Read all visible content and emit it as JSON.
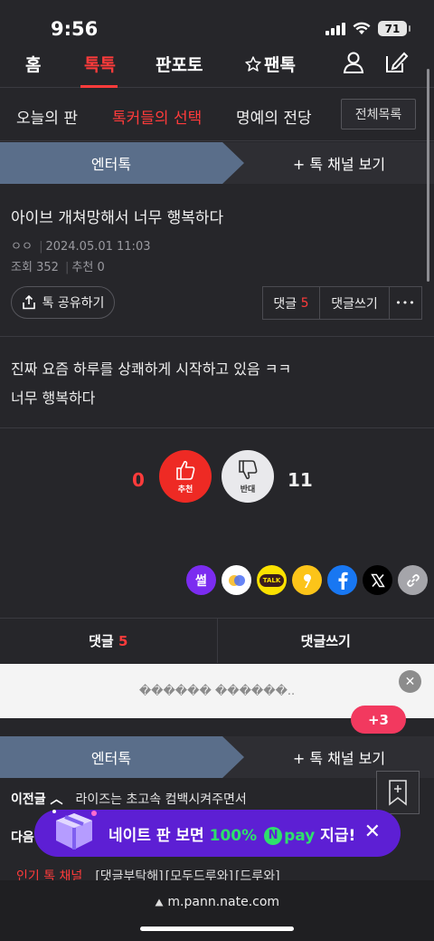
{
  "status_bar": {
    "time": "9:56",
    "battery": "71"
  },
  "gnb": {
    "items": [
      "홈",
      "톡톡",
      "판포토",
      "팬톡"
    ],
    "active": "톡톡"
  },
  "subnav": {
    "items": [
      "오늘의 판",
      "톡커들의 선택",
      "명예의 전당"
    ],
    "active": "톡커들의 선택",
    "all_button": "전체목록"
  },
  "channel": {
    "name": "엔터톡",
    "more": "+ 톡 채널 보기"
  },
  "post": {
    "title": "아이브 개쳐망해서 너무 행복하다",
    "author": "ㅇㅇ",
    "date": "2024.05.01 11:03",
    "views_label": "조회",
    "views": "352",
    "recommend_label": "추천",
    "recommend": "0",
    "body_lines": [
      "진짜 요즘 하루를 상쾌하게 시작하고 있음 ㅋㅋ",
      "너무 행복하다"
    ]
  },
  "actions": {
    "share_label": "톡 공유하기",
    "comments_label": "댓글",
    "comments_count": "5",
    "write_comment_label": "댓글쓰기",
    "more_label": "•••"
  },
  "vote": {
    "up_count": "0",
    "up_label": "추천",
    "down_count": "11",
    "down_label": "반대",
    "up_color": "#ee2a24"
  },
  "share_icons": [
    "ssul-icon",
    "bubble-icon",
    "kakaotalk-icon",
    "kakaostory-icon",
    "facebook-icon",
    "x-icon",
    "link-icon"
  ],
  "share_texts": {
    "ssul": "썰",
    "talk": "TALK"
  },
  "ad": {
    "text": "������ ������.."
  },
  "badge": {
    "text": "+3"
  },
  "prev_post": {
    "label": "이전글",
    "title": "라이즈는 초고속 컴백시켜주면서"
  },
  "next_post": {
    "label": "다음"
  },
  "promo": {
    "text_a": "네이트 판 보면 ",
    "pct": "100%",
    "n": "N",
    "pay": "pay",
    "text_b": " 지급!"
  },
  "popular": {
    "label": "인기 톡 채널",
    "items": [
      "[댓글부탁해]",
      "[모두드루와]",
      "[드루와]"
    ]
  },
  "browser": {
    "url": "m.pann.nate.com"
  }
}
